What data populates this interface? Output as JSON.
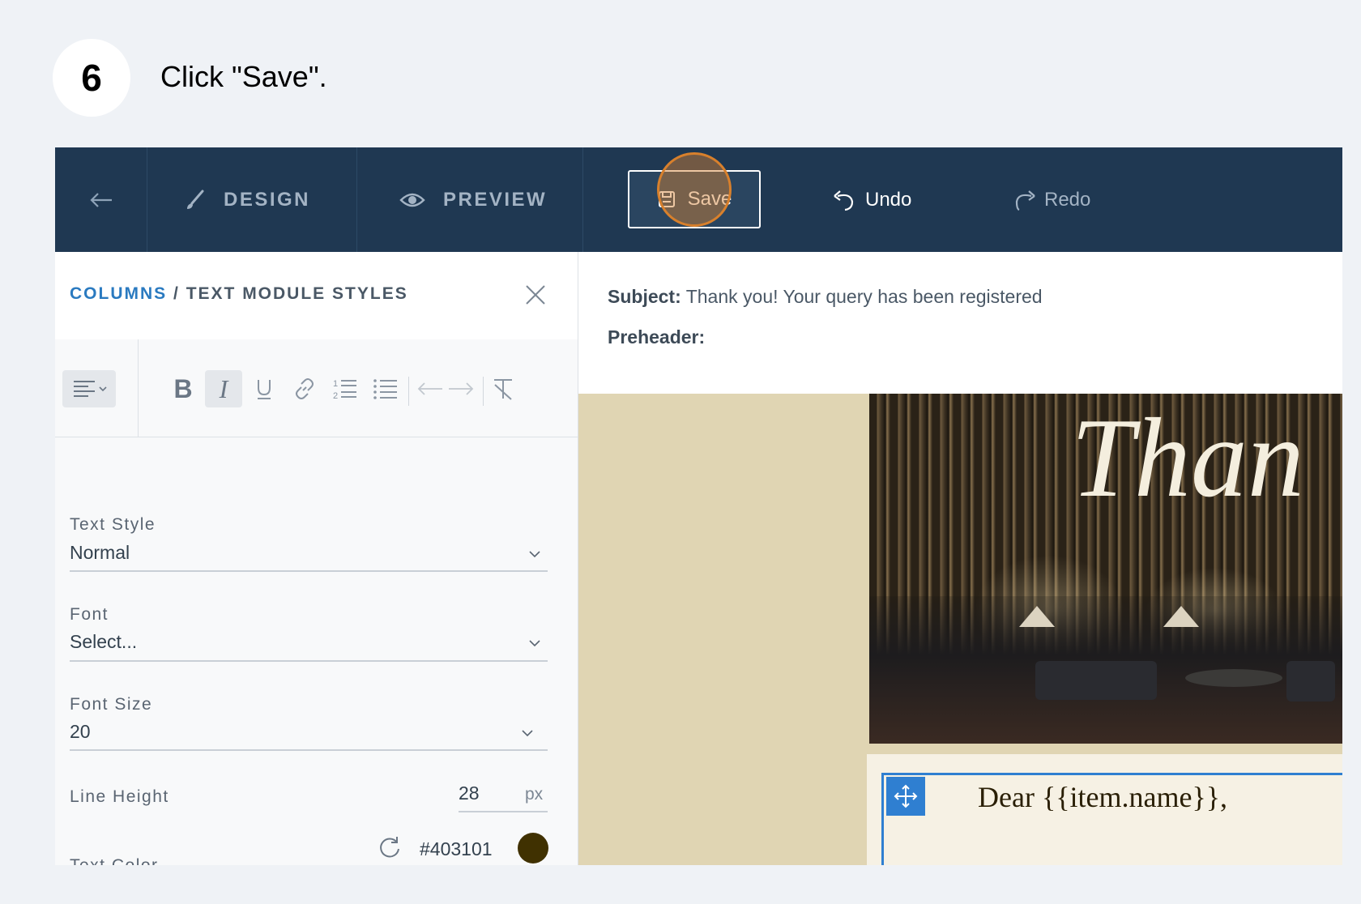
{
  "step": {
    "number": "6",
    "instruction": "Click \"Save\"."
  },
  "toolbar": {
    "back_icon": "arrow-left-icon",
    "design_label": "DESIGN",
    "preview_label": "PREVIEW",
    "save_label": "Save",
    "undo_label": "Undo",
    "redo_label": "Redo"
  },
  "panel": {
    "breadcrumb_link": "COLUMNS",
    "breadcrumb_sep": " / ",
    "breadcrumb_current": "TEXT MODULE STYLES",
    "fields": {
      "text_style_label": "Text Style",
      "text_style_value": "Normal",
      "font_label": "Font",
      "font_value": "Select...",
      "font_size_label": "Font Size",
      "font_size_value": "20",
      "line_height_label": "Line Height",
      "line_height_value": "28",
      "line_height_unit": "px",
      "text_color_label": "Text Color",
      "text_color_value": "#403101"
    }
  },
  "email": {
    "subject_label": "Subject:",
    "subject_value": "Thank you! Your query has been registered",
    "preheader_label": "Preheader:",
    "hero_text": "Than",
    "greeting": "Dear {{item.name}},"
  },
  "colors": {
    "toolbar_bg": "#1f3852",
    "accent_blue": "#2a7ac0",
    "highlight_orange": "#d8802c",
    "text_color_swatch": "#403101"
  }
}
